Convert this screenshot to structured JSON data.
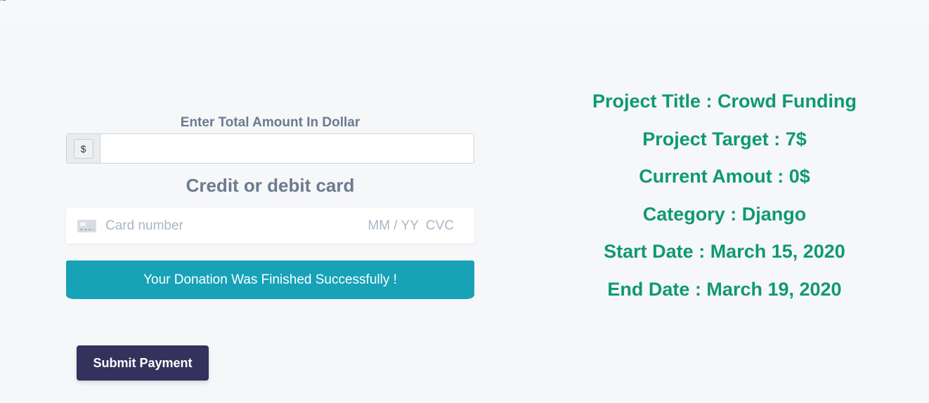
{
  "topbar": {
    "glyph": "ld"
  },
  "donation_form": {
    "amount_label": "Enter Total Amount In Dollar",
    "currency_symbol": "$",
    "amount_value": "",
    "card_heading": "Credit or debit card",
    "card": {
      "icon": "credit-card-icon",
      "number_placeholder": "Card number",
      "expiry_placeholder": "MM / YY",
      "cvc_placeholder": "CVC"
    },
    "success_message": "Your Donation Was Finished Successfully !",
    "submit_label": "Submit Payment"
  },
  "project": {
    "title": "Project Title : Crowd Funding",
    "target": "Project Target : 7$",
    "current_amount": "Current Amout : 0$",
    "category": "Category : Django",
    "start_date": "Start Date : March 15, 2020",
    "end_date": "End Date : March 19, 2020"
  },
  "colors": {
    "accent_green": "#0f9a6e",
    "alert_info": "#17a2b8",
    "button_dark": "#32325d",
    "label_gray": "#6b7a90"
  }
}
